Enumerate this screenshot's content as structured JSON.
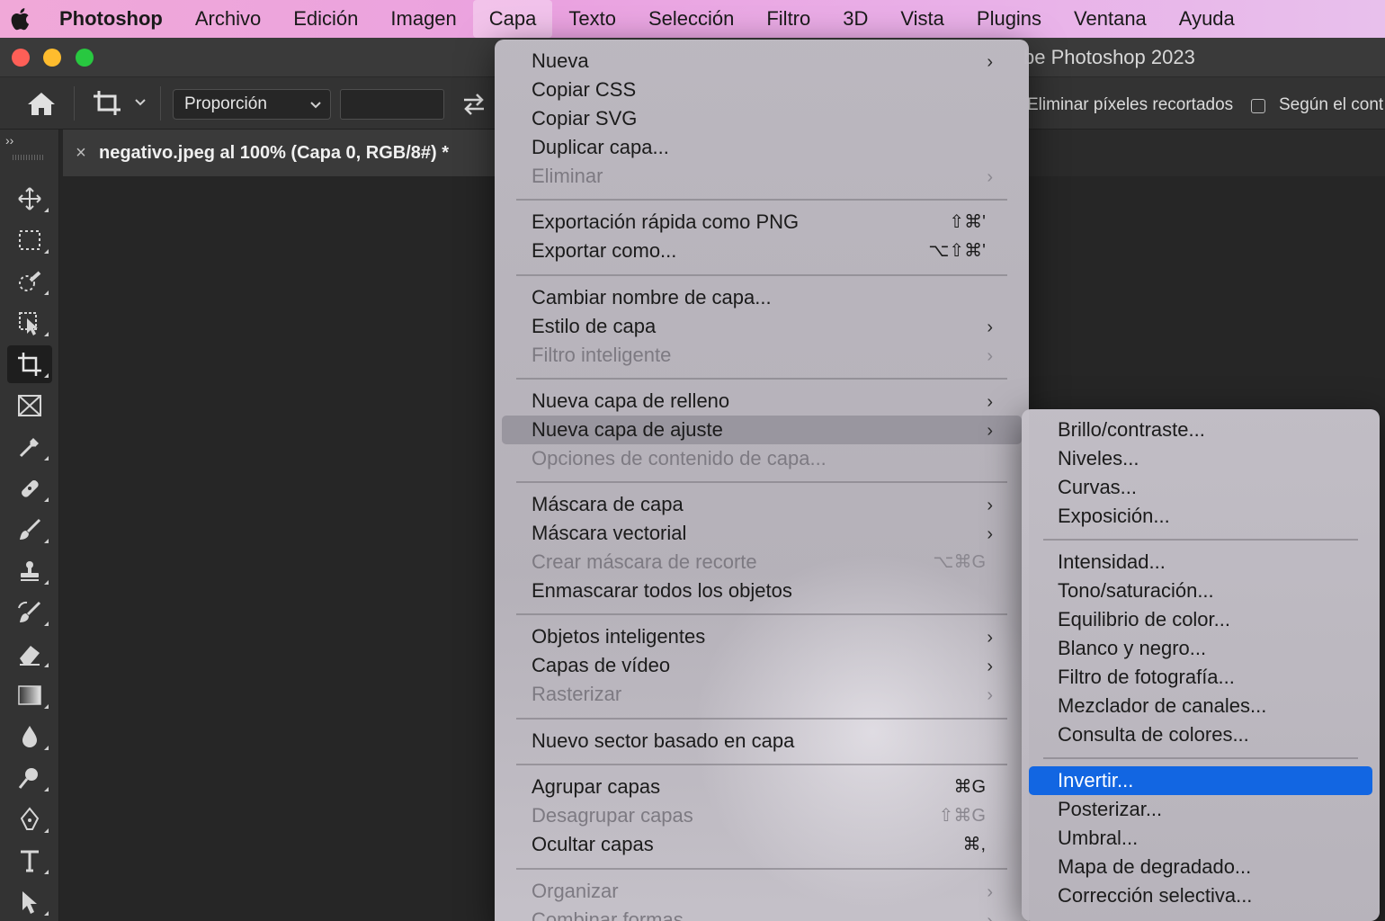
{
  "menubar": {
    "app_name": "Photoshop",
    "items": [
      "Archivo",
      "Edición",
      "Imagen",
      "Capa",
      "Texto",
      "Selección",
      "Filtro",
      "3D",
      "Vista",
      "Plugins",
      "Ventana",
      "Ayuda"
    ],
    "active": "Capa"
  },
  "window": {
    "title": "be Photoshop 2023"
  },
  "options": {
    "ratio_select": "Proporción",
    "delete_pixels": "Eliminar píxeles recortados",
    "content_aware": "Según el cont"
  },
  "document": {
    "tab_label": "negativo.jpeg al 100% (Capa 0, RGB/8#) *",
    "close_glyph": "×"
  },
  "tools_collapse": "››",
  "layer_menu": {
    "items": [
      {
        "label": "Nueva",
        "arrow": true
      },
      {
        "label": "Copiar CSS"
      },
      {
        "label": "Copiar SVG"
      },
      {
        "label": "Duplicar capa..."
      },
      {
        "label": "Eliminar",
        "disabled": true,
        "arrow": true
      },
      {
        "label": "Exportación rápida como PNG",
        "shortcut": "⇧⌘'"
      },
      {
        "label": "Exportar como...",
        "shortcut": "⌥⇧⌘'"
      },
      {
        "label": "Cambiar nombre de capa..."
      },
      {
        "label": "Estilo de capa",
        "arrow": true
      },
      {
        "label": "Filtro inteligente",
        "disabled": true,
        "arrow": true
      },
      {
        "label": "Nueva capa de relleno",
        "arrow": true
      },
      {
        "label": "Nueva capa de ajuste",
        "arrow": true,
        "hover": true
      },
      {
        "label": "Opciones de contenido de capa...",
        "disabled": true
      },
      {
        "label": "Máscara de capa",
        "arrow": true
      },
      {
        "label": "Máscara vectorial",
        "arrow": true
      },
      {
        "label": "Crear máscara de recorte",
        "disabled": true,
        "shortcut": "⌥⌘G"
      },
      {
        "label": "Enmascarar todos los objetos"
      },
      {
        "label": "Objetos inteligentes",
        "arrow": true
      },
      {
        "label": "Capas de vídeo",
        "arrow": true
      },
      {
        "label": "Rasterizar",
        "disabled": true,
        "arrow": true
      },
      {
        "label": "Nuevo sector basado en capa"
      },
      {
        "label": "Agrupar capas",
        "shortcut": "⌘G"
      },
      {
        "label": "Desagrupar capas",
        "disabled": true,
        "shortcut": "⇧⌘G"
      },
      {
        "label": "Ocultar capas",
        "shortcut": "⌘,"
      },
      {
        "label": "Organizar",
        "disabled": true,
        "arrow": true
      },
      {
        "label": "Combinar formas",
        "disabled": true,
        "arrow": true
      }
    ],
    "arrow_glyph": "›"
  },
  "adjustment_submenu": {
    "items": [
      "Brillo/contraste...",
      "Niveles...",
      "Curvas...",
      "Exposición...",
      "Intensidad...",
      "Tono/saturación...",
      "Equilibrio de color...",
      "Blanco y negro...",
      "Filtro de fotografía...",
      "Mezclador de canales...",
      "Consulta de colores...",
      "Invertir...",
      "Posterizar...",
      "Umbral...",
      "Mapa de degradado...",
      "Corrección selectiva..."
    ],
    "selected": "Invertir..."
  },
  "colors": {
    "menubar_gradient": "#eaa2e0",
    "selection_blue": "#1266e2",
    "panel_bg": "#333333",
    "canvas_bg": "#262626"
  }
}
